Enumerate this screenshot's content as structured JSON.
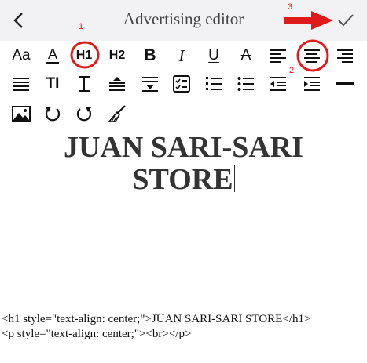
{
  "header": {
    "title": "Advertising editor",
    "back_icon": "chevron-left-icon",
    "confirm_icon": "check-icon"
  },
  "annotations": {
    "marker1": "1",
    "marker2": "2",
    "marker3": "3",
    "color": "#e01a1a"
  },
  "toolbar": {
    "font_label": "Aa",
    "h1_label": "H1",
    "h2_label": "H2",
    "bold_label": "B",
    "italic_label": "I",
    "underline_label": "U",
    "strike_label": "A",
    "font_color_label": "A",
    "text_height_label": "TI"
  },
  "editor": {
    "heading": "JUAN SARI-SARI STORE"
  },
  "source": {
    "line1": "<h1 style=\"text-align: center;\">JUAN SARI-SARI STORE</h1>",
    "line2": "<p style=\"text-align: center;\"><br></p>"
  }
}
